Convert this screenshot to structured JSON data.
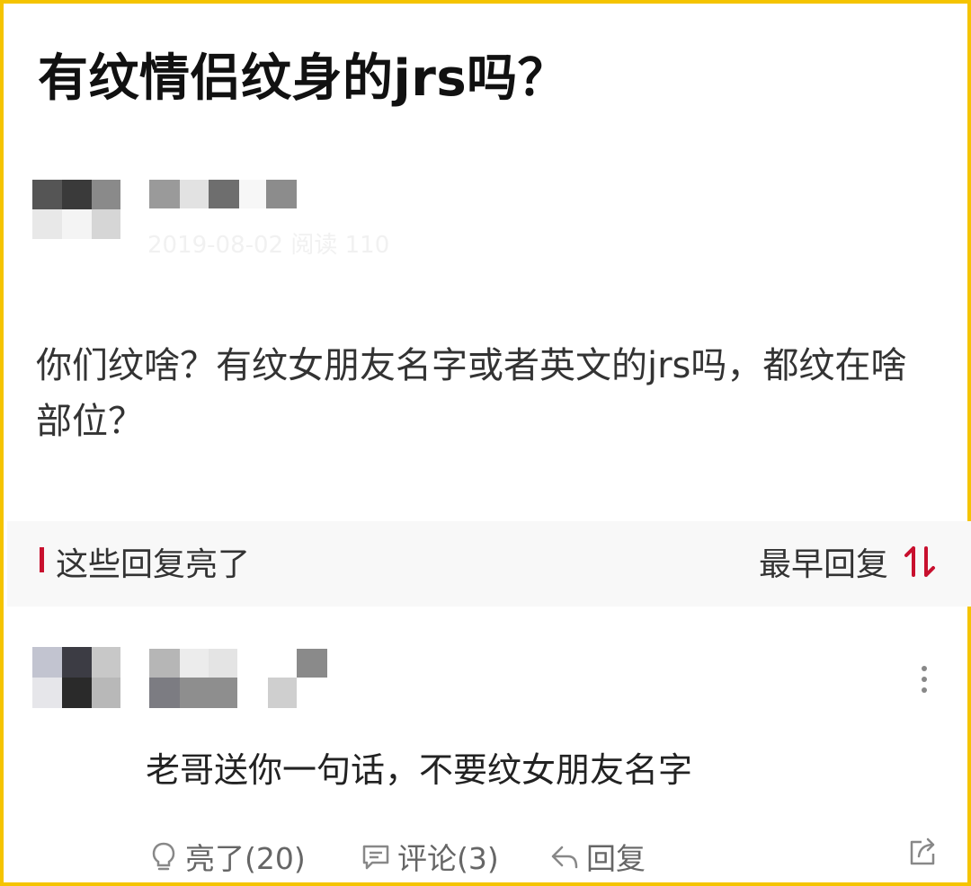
{
  "post": {
    "title": "有纹情侣纹身的jrs吗？",
    "meta_obscured": "2019-08-02 阅读 110",
    "body": "你们纹啥？有纹女朋友名字或者英文的jrs吗，都纹在啥部位？"
  },
  "replies_section": {
    "title": "这些回复亮了",
    "sort_label": "最早回复",
    "accent_color": "#c8102e"
  },
  "reply": {
    "text": "老哥送你一句话，不要纹女朋友名字",
    "actions": {
      "like": "亮了(20)",
      "comment": "评论(3)",
      "reply": "回复"
    }
  },
  "icons": [
    "bulb-icon",
    "comment-bubble-icon",
    "reply-arrow-icon",
    "share-icon",
    "more-vertical-icon",
    "sort-arrows-icon"
  ]
}
